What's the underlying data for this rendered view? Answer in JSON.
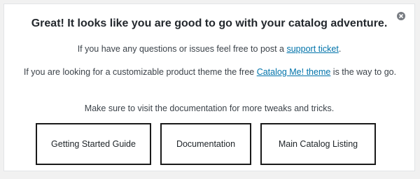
{
  "notice": {
    "title": "Great! It looks like you are good to go with your catalog adventure.",
    "line1_before": "If you have any questions or issues feel free to post a ",
    "line1_link": "support ticket",
    "line1_after": ".",
    "line2_before": "If you are looking for a customizable product theme the free ",
    "line2_link": "Catalog Me! theme",
    "line2_after": " is the way to go.",
    "line3": "Make sure to visit the documentation for more tweaks and tricks.",
    "dismiss_icon": "close-circle-icon"
  },
  "buttons": [
    {
      "label": "Getting Started Guide"
    },
    {
      "label": "Documentation"
    },
    {
      "label": "Main Catalog Listing"
    }
  ],
  "colors": {
    "link": "#0073aa",
    "button_border": "#1a1a1a",
    "background": "#f1f1f1"
  }
}
